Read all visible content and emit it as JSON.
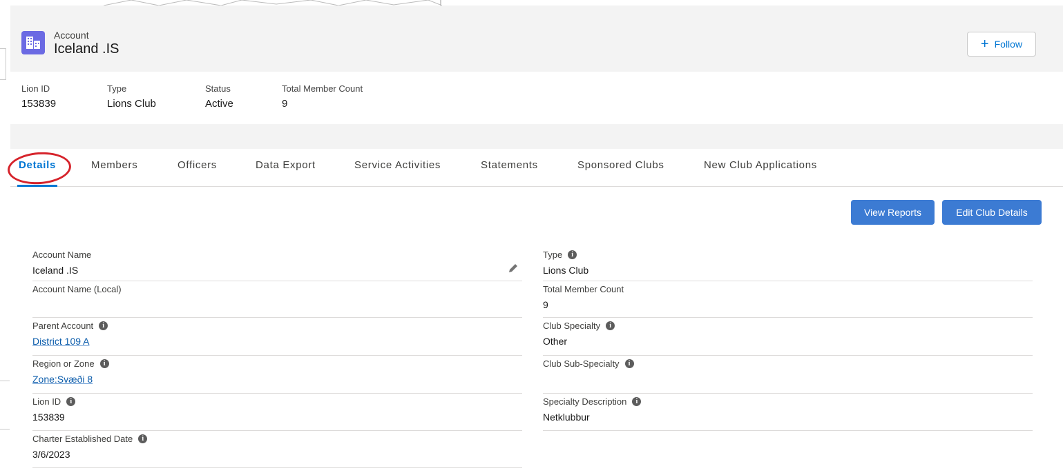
{
  "header": {
    "object_label": "Account",
    "title": "Iceland .IS",
    "follow_label": "Follow"
  },
  "highlights": [
    {
      "label": "Lion ID",
      "value": "153839"
    },
    {
      "label": "Type",
      "value": "Lions Club"
    },
    {
      "label": "Status",
      "value": "Active"
    },
    {
      "label": "Total Member Count",
      "value": "9"
    }
  ],
  "tabs": [
    {
      "label": "Details",
      "active": true
    },
    {
      "label": "Members"
    },
    {
      "label": "Officers"
    },
    {
      "label": "Data Export"
    },
    {
      "label": "Service Activities"
    },
    {
      "label": "Statements"
    },
    {
      "label": "Sponsored Clubs"
    },
    {
      "label": "New Club Applications"
    }
  ],
  "actions": {
    "view_reports": "View Reports",
    "edit_club_details": "Edit Club Details"
  },
  "details_left": [
    {
      "label": "Account Name",
      "value": "Iceland .IS",
      "editable": true
    },
    {
      "label": "Account Name (Local)",
      "value": ""
    },
    {
      "label": "Parent Account",
      "value": "District 109 A",
      "link": true,
      "info": true
    },
    {
      "label": "Region or Zone",
      "value": "Zone:Svæði 8",
      "link": true,
      "info": true
    },
    {
      "label": "Lion ID",
      "value": "153839",
      "info": true
    },
    {
      "label": "Charter Established Date",
      "value": "3/6/2023",
      "info": true
    }
  ],
  "details_right": [
    {
      "label": "Type",
      "value": "Lions Club",
      "info": true
    },
    {
      "label": "Total Member Count",
      "value": "9"
    },
    {
      "label": "Club Specialty",
      "value": "Other",
      "info": true
    },
    {
      "label": "Club Sub-Specialty",
      "value": "",
      "info": true
    },
    {
      "label": "Specialty Description",
      "value": "Netklubbur",
      "info": true
    }
  ],
  "info_glyph": "i",
  "colors": {
    "brand_blue": "#0176d3",
    "button_blue": "#3c7bd3",
    "account_icon": "#6b6ae3",
    "annotation_red": "#d6232b"
  }
}
